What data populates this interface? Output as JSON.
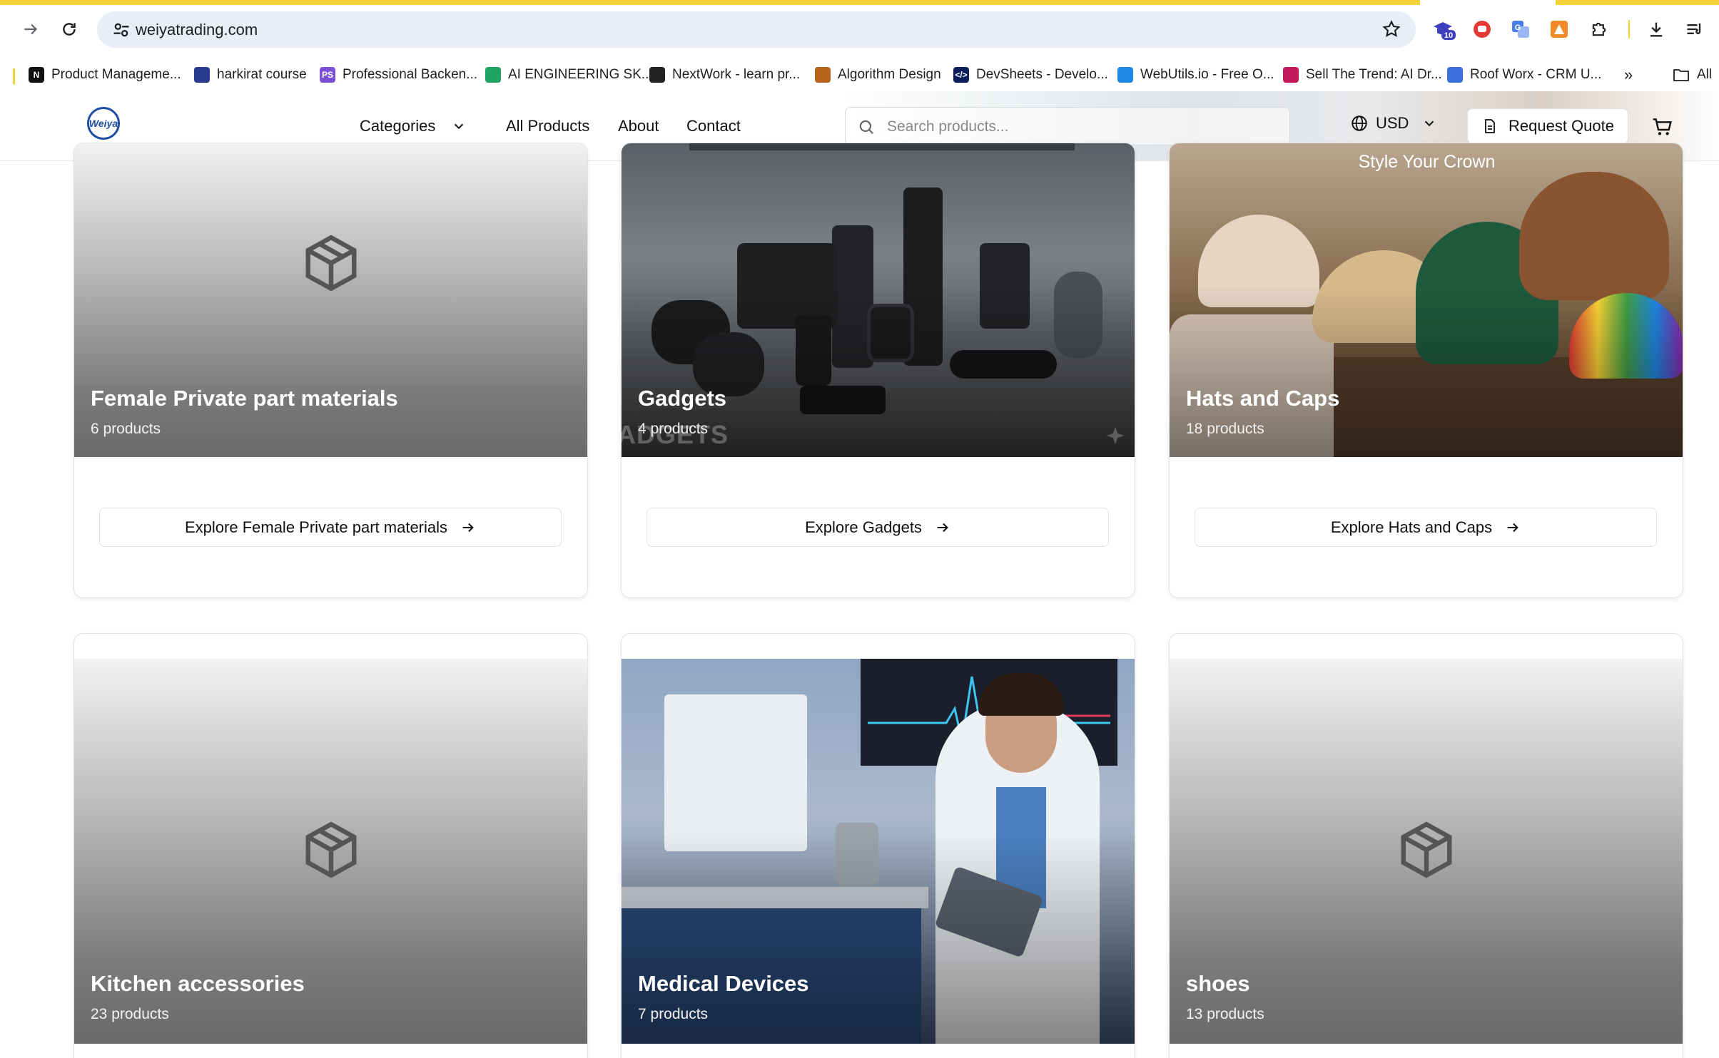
{
  "browser": {
    "url": "weiyatrading.com",
    "ext_badge": "10",
    "bookmarks": [
      {
        "label": "Product Manageme...",
        "color": "#111111",
        "glyph": "N"
      },
      {
        "label": "harkirat course",
        "color": "#2a3b8f",
        "glyph": ""
      },
      {
        "label": "Professional Backen...",
        "color": "#7b4fd6",
        "glyph": "PS"
      },
      {
        "label": "AI ENGINEERING SK...",
        "color": "#1fa463",
        "glyph": ""
      },
      {
        "label": "NextWork - learn pr...",
        "color": "#222222",
        "glyph": ""
      },
      {
        "label": "Algorithm Design",
        "color": "#b5651d",
        "glyph": ""
      },
      {
        "label": "DevSheets - Develo...",
        "color": "#0b1e5c",
        "glyph": "</>"
      },
      {
        "label": "WebUtils.io - Free O...",
        "color": "#1e88e5",
        "glyph": ""
      },
      {
        "label": "Sell The Trend: AI Dr...",
        "color": "#c2185b",
        "glyph": ""
      },
      {
        "label": "Roof Worx - CRM U...",
        "color": "#3b6fd9",
        "glyph": ""
      }
    ],
    "overflow_label": "»",
    "all_bookmarks_label": "All"
  },
  "header": {
    "logo_text": "Weiya",
    "nav": {
      "categories": "Categories",
      "all_products": "All Products",
      "about": "About",
      "contact": "Contact"
    },
    "search_placeholder": "Search products...",
    "currency": "USD",
    "request_quote": "Request Quote"
  },
  "categories": [
    {
      "name": "Female Private part materials",
      "count": "6 products",
      "explore": "Explore Female Private part materials",
      "image": "placeholder"
    },
    {
      "name": "Gadgets",
      "count": "4 products",
      "explore": "Explore Gadgets",
      "image": "photo",
      "watermark": "ADGETS"
    },
    {
      "name": "Hats and Caps",
      "count": "18 products",
      "explore": "Explore Hats and Caps",
      "image": "photo",
      "tagline": "Style Your Crown"
    },
    {
      "name": "Kitchen accessories",
      "count": "23 products",
      "image": "placeholder"
    },
    {
      "name": "Medical Devices",
      "count": "7 products",
      "image": "photo"
    },
    {
      "name": "shoes",
      "count": "13 products",
      "image": "placeholder"
    }
  ],
  "colors": {
    "accent_strip": "#f4d23a",
    "omnibox": "#e9eef6",
    "logo_blue": "#1f4fa3"
  }
}
